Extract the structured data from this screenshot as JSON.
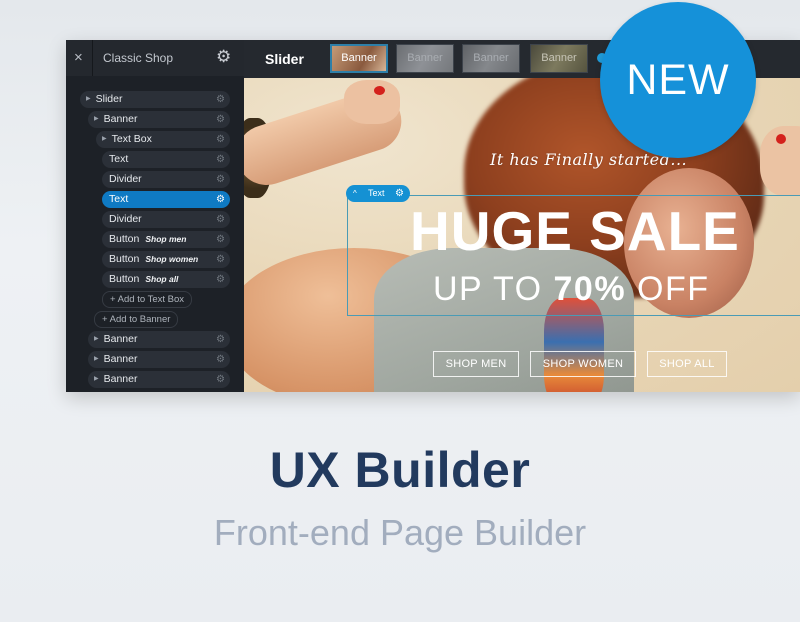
{
  "sidebar": {
    "close_icon": "×",
    "title": "Classic Shop",
    "settings_icon": "⚙",
    "tree": [
      {
        "label": "Slider",
        "sub": "",
        "level": 0,
        "caret": true,
        "selected": false
      },
      {
        "label": "Banner",
        "sub": "",
        "level": 1,
        "caret": true,
        "selected": false
      },
      {
        "label": "Text Box",
        "sub": "",
        "level": 2,
        "caret": true,
        "selected": false
      },
      {
        "label": "Text",
        "sub": "",
        "level": 3,
        "caret": false,
        "selected": false
      },
      {
        "label": "Divider",
        "sub": "",
        "level": 3,
        "caret": false,
        "selected": false
      },
      {
        "label": "Text",
        "sub": "",
        "level": 3,
        "caret": false,
        "selected": true
      },
      {
        "label": "Divider",
        "sub": "",
        "level": 3,
        "caret": false,
        "selected": false
      },
      {
        "label": "Button",
        "sub": "Shop men",
        "level": 3,
        "caret": false,
        "selected": false
      },
      {
        "label": "Button",
        "sub": "Shop women",
        "level": 3,
        "caret": false,
        "selected": false
      },
      {
        "label": "Button",
        "sub": "Shop all",
        "level": 3,
        "caret": false,
        "selected": false
      }
    ],
    "add_to_text_box": "+ Add to Text Box",
    "add_to_banner": "+ Add to Banner",
    "more_banners": [
      {
        "label": "Banner"
      },
      {
        "label": "Banner"
      },
      {
        "label": "Banner"
      }
    ]
  },
  "topbar": {
    "title": "Slider",
    "thumbnails": [
      {
        "label": "Banner",
        "active": true
      },
      {
        "label": "Banner",
        "active": false
      },
      {
        "label": "Banner",
        "active": false
      },
      {
        "label": "Banner",
        "active": false
      }
    ]
  },
  "canvas": {
    "tagline": "It has Finally started...",
    "selection_tag": {
      "chevron": "^",
      "label": "Text",
      "gear": "⚙"
    },
    "headline": "HUGE SALE",
    "subline_prefix": "UP TO ",
    "subline_bold": "70%",
    "subline_suffix": " OFF",
    "buttons": [
      "SHOP MEN",
      "SHOP WOMEN",
      "SHOP ALL"
    ]
  },
  "badge": {
    "label": "NEW",
    "color": "#1591d9"
  },
  "footer": {
    "title": "UX Builder",
    "subtitle": "Front-end Page Builder"
  }
}
